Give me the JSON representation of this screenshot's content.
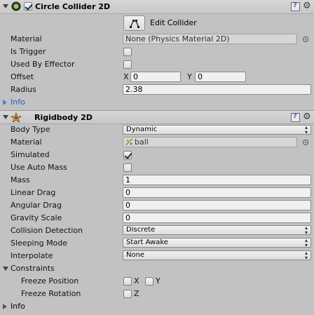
{
  "circle_collider": {
    "title": "Circle Collider 2D",
    "enabled": true,
    "edit_collider_label": "Edit Collider",
    "material_label": "Material",
    "material_value": "None (Physics Material 2D)",
    "is_trigger_label": "Is Trigger",
    "is_trigger": false,
    "used_by_effector_label": "Used By Effector",
    "used_by_effector": false,
    "offset_label": "Offset",
    "offset_x_label": "X",
    "offset_x": "0",
    "offset_y_label": "Y",
    "offset_y": "0",
    "radius_label": "Radius",
    "radius": "2.38",
    "info_label": "Info"
  },
  "rigidbody": {
    "title": "Rigidbody 2D",
    "body_type_label": "Body Type",
    "body_type": "Dynamic",
    "material_label": "Material",
    "material_value": "ball",
    "simulated_label": "Simulated",
    "simulated": true,
    "use_auto_mass_label": "Use Auto Mass",
    "use_auto_mass": false,
    "mass_label": "Mass",
    "mass": "1",
    "linear_drag_label": "Linear Drag",
    "linear_drag": "0",
    "angular_drag_label": "Angular Drag",
    "angular_drag": "0",
    "gravity_scale_label": "Gravity Scale",
    "gravity_scale": "0",
    "collision_detection_label": "Collision Detection",
    "collision_detection": "Discrete",
    "sleeping_mode_label": "Sleeping Mode",
    "sleeping_mode": "Start Awake",
    "interpolate_label": "Interpolate",
    "interpolate": "None",
    "constraints_label": "Constraints",
    "freeze_position_label": "Freeze Position",
    "freeze_position_x_label": "X",
    "freeze_position_y_label": "Y",
    "freeze_rotation_label": "Freeze Rotation",
    "freeze_rotation_z_label": "Z",
    "info_label": "Info"
  },
  "icons": {
    "collider_icon": "circle-collider-icon",
    "rigidbody_icon": "rigidbody-icon",
    "help": "help-book-icon",
    "settings": "gear-icon",
    "object_picker": "object-picker-icon"
  },
  "colors": {
    "panel_bg": "#c2c2c2",
    "header_bg": "#d0d0d0",
    "info_link": "#2b57b8"
  }
}
